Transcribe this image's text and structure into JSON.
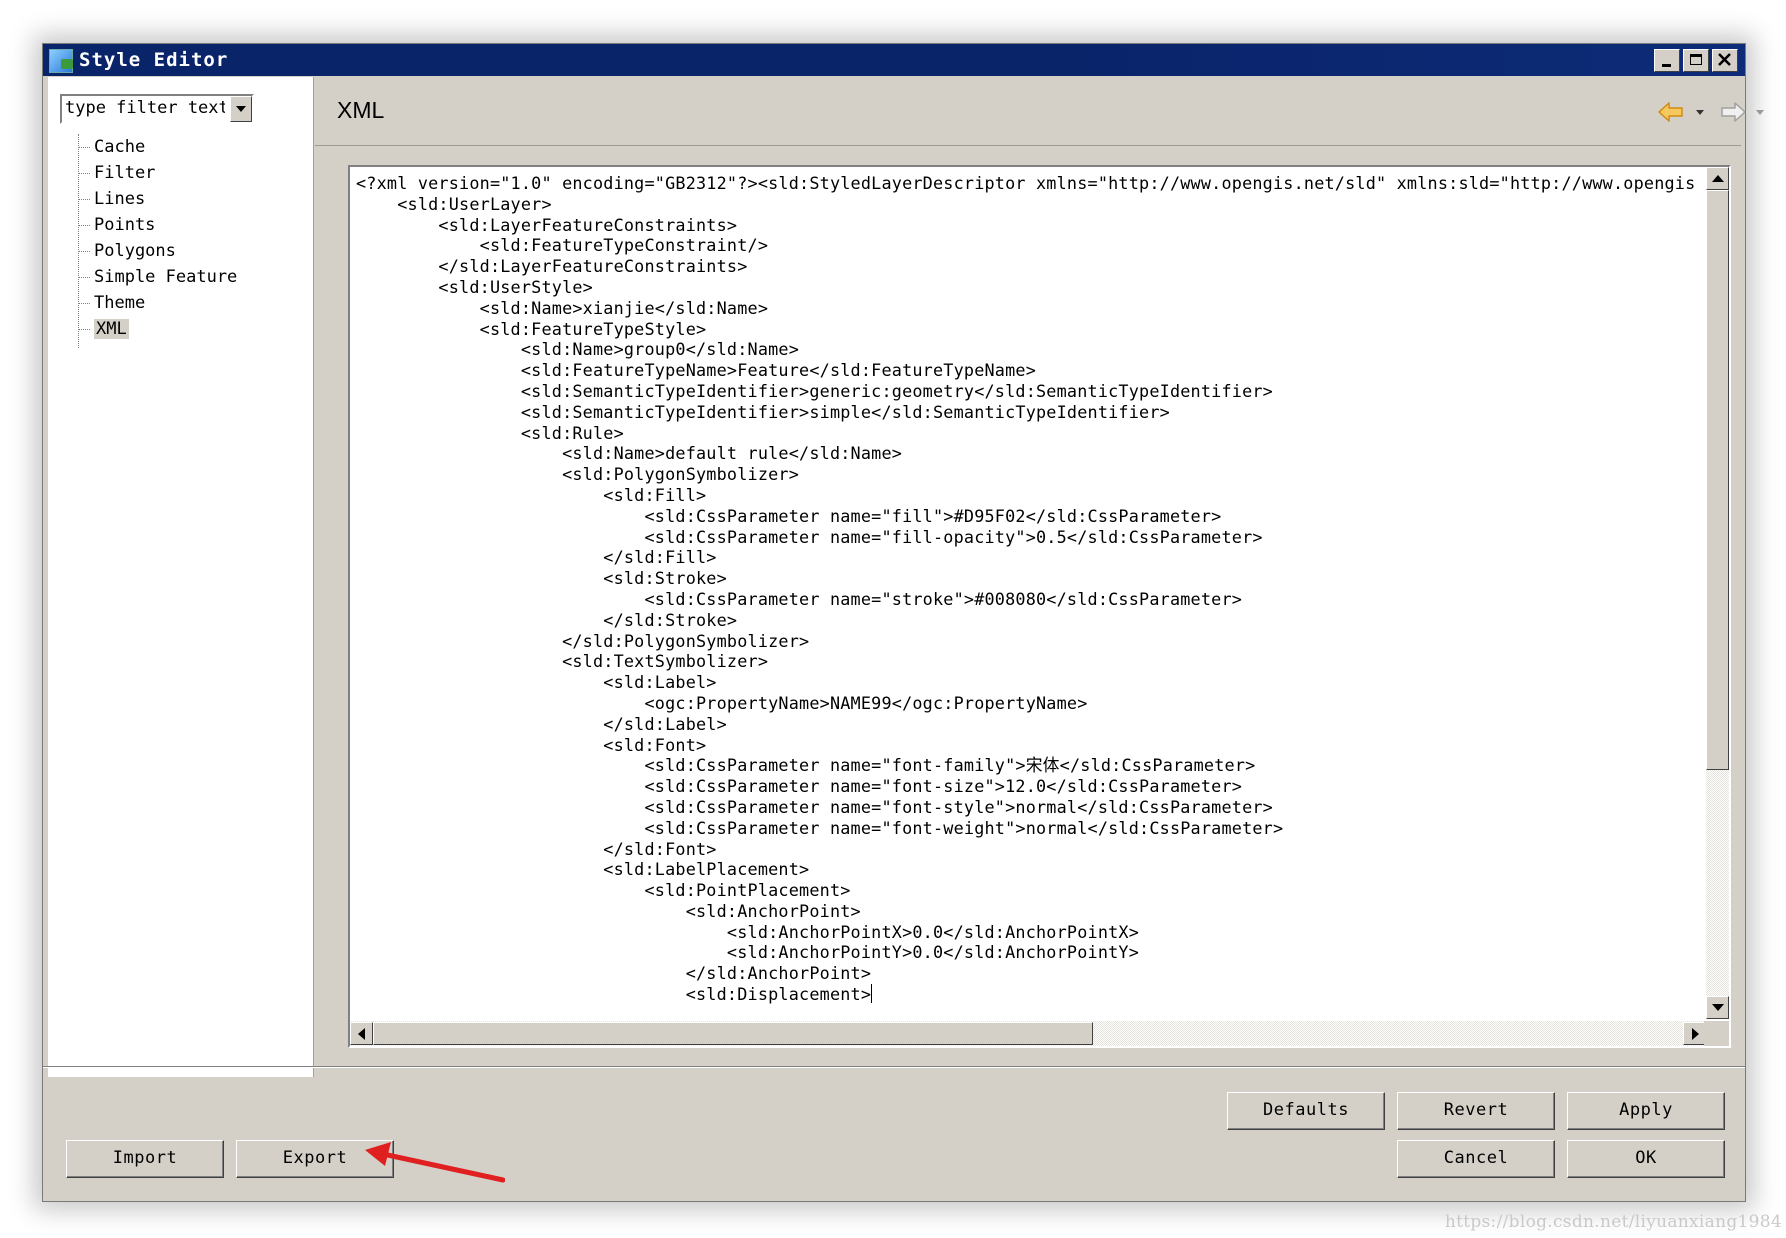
{
  "window": {
    "title": "Style Editor",
    "controls": [
      "minimize",
      "maximize",
      "close"
    ]
  },
  "sidebar": {
    "filter_text": "type filter text",
    "items": [
      {
        "label": "Cache"
      },
      {
        "label": "Filter"
      },
      {
        "label": "Lines"
      },
      {
        "label": "Points"
      },
      {
        "label": "Polygons"
      },
      {
        "label": "Simple Feature"
      },
      {
        "label": "Theme"
      },
      {
        "label": "XML",
        "selected": true
      }
    ]
  },
  "page": {
    "title": "XML",
    "nav_back_icon": "back-arrow-icon",
    "nav_forward_icon": "forward-arrow-icon"
  },
  "editor": {
    "lines": [
      "<?xml version=\"1.0\" encoding=\"GB2312\"?><sld:StyledLayerDescriptor xmlns=\"http://www.opengis.net/sld\" xmlns:sld=\"http://www.opengis",
      "    <sld:UserLayer>",
      "        <sld:LayerFeatureConstraints>",
      "            <sld:FeatureTypeConstraint/>",
      "        </sld:LayerFeatureConstraints>",
      "        <sld:UserStyle>",
      "            <sld:Name>xianjie</sld:Name>",
      "            <sld:FeatureTypeStyle>",
      "                <sld:Name>group0</sld:Name>",
      "                <sld:FeatureTypeName>Feature</sld:FeatureTypeName>",
      "                <sld:SemanticTypeIdentifier>generic:geometry</sld:SemanticTypeIdentifier>",
      "                <sld:SemanticTypeIdentifier>simple</sld:SemanticTypeIdentifier>",
      "                <sld:Rule>",
      "                    <sld:Name>default rule</sld:Name>",
      "                    <sld:PolygonSymbolizer>",
      "                        <sld:Fill>",
      "                            <sld:CssParameter name=\"fill\">#D95F02</sld:CssParameter>",
      "                            <sld:CssParameter name=\"fill-opacity\">0.5</sld:CssParameter>",
      "                        </sld:Fill>",
      "                        <sld:Stroke>",
      "                            <sld:CssParameter name=\"stroke\">#008080</sld:CssParameter>",
      "                        </sld:Stroke>",
      "                    </sld:PolygonSymbolizer>",
      "                    <sld:TextSymbolizer>",
      "                        <sld:Label>",
      "                            <ogc:PropertyName>NAME99</ogc:PropertyName>",
      "                        </sld:Label>",
      "                        <sld:Font>",
      "                            <sld:CssParameter name=\"font-family\">宋体</sld:CssParameter>",
      "                            <sld:CssParameter name=\"font-size\">12.0</sld:CssParameter>",
      "                            <sld:CssParameter name=\"font-style\">normal</sld:CssParameter>",
      "                            <sld:CssParameter name=\"font-weight\">normal</sld:CssParameter>",
      "                        </sld:Font>",
      "                        <sld:LabelPlacement>",
      "                            <sld:PointPlacement>",
      "                                <sld:AnchorPoint>",
      "                                    <sld:AnchorPointX>0.0</sld:AnchorPointX>",
      "                                    <sld:AnchorPointY>0.0</sld:AnchorPointY>",
      "                                </sld:AnchorPoint>",
      "                                <sld:Displacement>"
    ]
  },
  "buttons": {
    "import": "Import",
    "export": "Export",
    "defaults": "Defaults",
    "revert": "Revert",
    "apply": "Apply",
    "cancel": "Cancel",
    "ok": "OK"
  },
  "annotation": {
    "arrow_color": "#e02020"
  },
  "watermark": "https://blog.csdn.net/liyuanxiang1984",
  "colors": {
    "titlebar": "#0a246a",
    "window_bg": "#d4d0c8",
    "nav_arrow": "#f0a020"
  }
}
